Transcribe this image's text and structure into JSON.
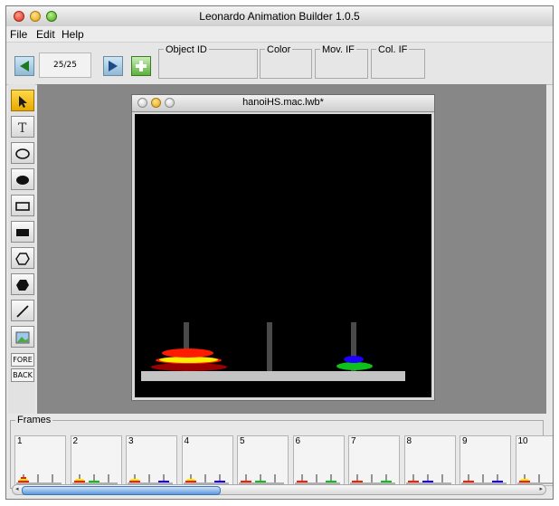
{
  "app": {
    "title": "Leonardo Animation Builder 1.0.5"
  },
  "menu": [
    "File",
    "Edit",
    "Help"
  ],
  "toolbar": {
    "frame_counter": "25/25",
    "fields": [
      "Object ID",
      "Color",
      "Mov. IF",
      "Col. IF"
    ]
  },
  "palette": {
    "tools": [
      "arrow-icon",
      "text-icon",
      "ellipse-outline-icon",
      "ellipse-filled-icon",
      "rect-outline-icon",
      "rect-filled-icon",
      "polygon-outline-icon",
      "polygon-filled-icon",
      "line-icon",
      "image-icon"
    ],
    "fore_label": "FORE",
    "back_label": "BACK"
  },
  "document": {
    "title": "hanoiHS.mac.lwb*"
  },
  "colors": {
    "red": "#ff1a00",
    "yellow": "#ffee00",
    "green": "#0ec01a",
    "blue": "#1e00ff",
    "dark_red": "#9a0000"
  },
  "frames": {
    "label": "Frames",
    "numbers": [
      "1",
      "2",
      "3",
      "4",
      "5",
      "6",
      "7",
      "8",
      "9",
      "10"
    ]
  }
}
